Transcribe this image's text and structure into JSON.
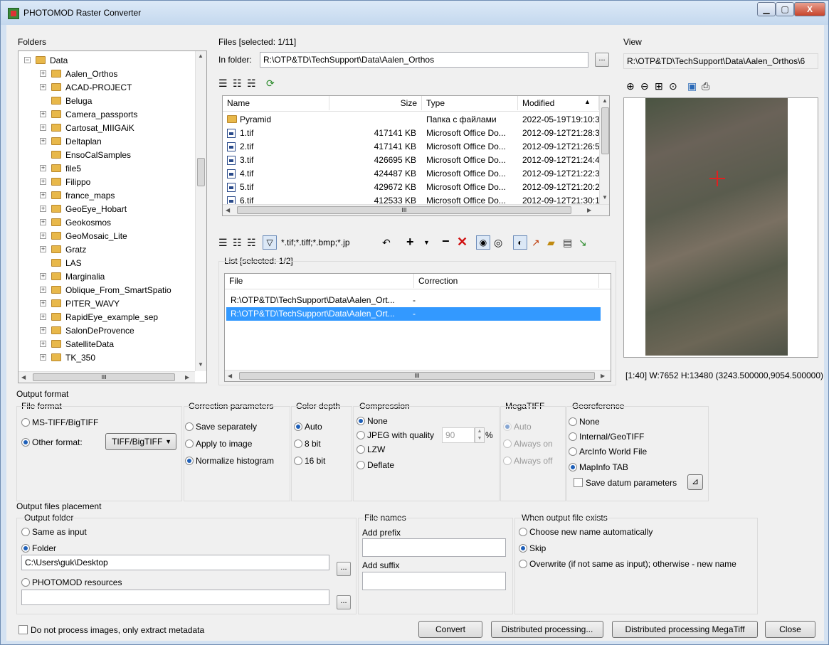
{
  "window": {
    "title": "PHOTOMOD Raster Converter",
    "min": "▁",
    "max": "▢",
    "close": "X"
  },
  "folders": {
    "label": "Folders",
    "items": [
      {
        "name": "Data",
        "level": 0,
        "expand": "−"
      },
      {
        "name": "Aalen_Orthos",
        "level": 1,
        "expand": "+"
      },
      {
        "name": "ACAD-PROJECT",
        "level": 1,
        "expand": "+"
      },
      {
        "name": "Beluga",
        "level": 1,
        "expand": ""
      },
      {
        "name": "Camera_passports",
        "level": 1,
        "expand": "+"
      },
      {
        "name": "Cartosat_MIIGAiK",
        "level": 1,
        "expand": "+"
      },
      {
        "name": "Deltaplan",
        "level": 1,
        "expand": "+"
      },
      {
        "name": "EnsoCalSamples",
        "level": 1,
        "expand": ""
      },
      {
        "name": "file5",
        "level": 1,
        "expand": "+"
      },
      {
        "name": "Filippo",
        "level": 1,
        "expand": "+"
      },
      {
        "name": "france_maps",
        "level": 1,
        "expand": "+"
      },
      {
        "name": "GeoEye_Hobart",
        "level": 1,
        "expand": "+"
      },
      {
        "name": "Geokosmos",
        "level": 1,
        "expand": "+"
      },
      {
        "name": "GeoMosaic_Lite",
        "level": 1,
        "expand": "+"
      },
      {
        "name": "Gratz",
        "level": 1,
        "expand": "+"
      },
      {
        "name": "LAS",
        "level": 1,
        "expand": ""
      },
      {
        "name": "Marginalia",
        "level": 1,
        "expand": "+"
      },
      {
        "name": "Oblique_From_SmartSpatio",
        "level": 1,
        "expand": "+"
      },
      {
        "name": "PITER_WAVY",
        "level": 1,
        "expand": "+"
      },
      {
        "name": "RapidEye_example_sep",
        "level": 1,
        "expand": "+"
      },
      {
        "name": "SalonDeProvence",
        "level": 1,
        "expand": "+"
      },
      {
        "name": "SatelliteData",
        "level": 1,
        "expand": "+"
      },
      {
        "name": "TK_350",
        "level": 1,
        "expand": "+"
      }
    ],
    "hscroll_label": "III"
  },
  "files": {
    "label": "Files [selected: 1/11]",
    "in_folder_label": "In folder:",
    "in_folder_value": "R:\\OTP&TD\\TechSupport\\Data\\Aalen_Orthos",
    "browse": "...",
    "columns": [
      "Name",
      "Size",
      "Type",
      "Modified"
    ],
    "rows": [
      {
        "name": "Pyramid",
        "size": "",
        "type": "Папка с файлами",
        "modified": "2022-05-19T19:10:3",
        "folder": true
      },
      {
        "name": "1.tif",
        "size": "417141 KB",
        "type": "Microsoft Office Do...",
        "modified": "2012-09-12T21:28:3"
      },
      {
        "name": "2.tif",
        "size": "417141 KB",
        "type": "Microsoft Office Do...",
        "modified": "2012-09-12T21:26:5"
      },
      {
        "name": "3.tif",
        "size": "426695 KB",
        "type": "Microsoft Office Do...",
        "modified": "2012-09-12T21:24:4"
      },
      {
        "name": "4.tif",
        "size": "424487 KB",
        "type": "Microsoft Office Do...",
        "modified": "2012-09-12T21:22:3"
      },
      {
        "name": "5.tif",
        "size": "429672 KB",
        "type": "Microsoft Office Do...",
        "modified": "2012-09-12T21:20:2"
      },
      {
        "name": "6.tif",
        "size": "412533 KB",
        "type": "Microsoft Office Do...",
        "modified": "2012-09-12T21:30:1"
      }
    ],
    "hscroll_label": "III",
    "filter_text": "*.tif;*.tiff;*.bmp;*.jp"
  },
  "list": {
    "label": "List [selected: 1/2]",
    "columns": [
      "File",
      "Correction"
    ],
    "rows": [
      {
        "file": "R:\\OTP&TD\\TechSupport\\Data\\Aalen_Ort...",
        "correction": "-",
        "selected": false
      },
      {
        "file": "R:\\OTP&TD\\TechSupport\\Data\\Aalen_Ort...",
        "correction": "-",
        "selected": true
      }
    ],
    "hscroll_label": "III"
  },
  "view": {
    "label": "View",
    "path": "R:\\OTP&TD\\TechSupport\\Data\\Aalen_Orthos\\6",
    "status": "[1:40] W:7652 H:13480 (3243.500000,9054.500000)"
  },
  "output_format": {
    "label": "Output format",
    "file_format": {
      "label": "File format",
      "opt1": "MS-TIFF/BigTIFF",
      "opt2": "Other format:",
      "select": "TIFF/BigTIFF",
      "selected": 2
    },
    "correction": {
      "label": "Correction parameters",
      "opt1": "Save separately",
      "opt2": "Apply to image",
      "opt3": "Normalize histogram",
      "selected": 3
    },
    "color_depth": {
      "label": "Color depth",
      "opt1": "Auto",
      "opt2": "8 bit",
      "opt3": "16 bit",
      "selected": 1
    },
    "compression": {
      "label": "Compression",
      "opt1": "None",
      "opt2": "JPEG with quality",
      "quality": "90",
      "percent": "%",
      "opt3": "LZW",
      "opt4": "Deflate",
      "selected": 1
    },
    "megatiff": {
      "label": "MegaTIFF",
      "opt1": "Auto",
      "opt2": "Always on",
      "opt3": "Always off"
    },
    "georeference": {
      "label": "Georeference",
      "opt1": "None",
      "opt2": "Internal/GeoTIFF",
      "opt3": "ArcInfo World File",
      "opt4": "MapInfo TAB",
      "selected": 4,
      "save_datum": "Save datum parameters"
    }
  },
  "placement": {
    "label": "Output files placement",
    "output_folder": {
      "label": "Output folder",
      "opt1": "Same as input",
      "opt2": "Folder",
      "folder_value": "C:\\Users\\guk\\Desktop",
      "opt3": "PHOTOMOD resources",
      "resources_value": "",
      "selected": 2
    },
    "file_names": {
      "label": "File names",
      "prefix_label": "Add prefix",
      "prefix": "",
      "suffix_label": "Add suffix",
      "suffix": ""
    },
    "exists": {
      "label": "When output file exists",
      "opt1": "Choose new name automatically",
      "opt2": "Skip",
      "opt3": "Overwrite (if not same as input); otherwise - new name",
      "selected": 2
    }
  },
  "footer": {
    "metadata_only": "Do not process images, only extract metadata",
    "convert": "Convert",
    "distributed": "Distributed processing...",
    "distributed_mega": "Distributed processing MegaTiff",
    "close": "Close"
  },
  "colors": {
    "selection": "#3399ff",
    "folder": "#e8b84a",
    "radio_dot": "#1e5fb8",
    "title_bg": "#c4d8ee"
  }
}
